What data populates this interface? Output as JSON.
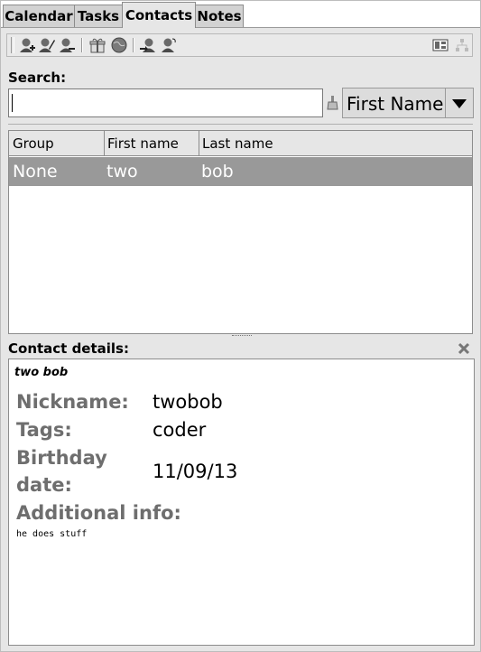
{
  "tabs": [
    {
      "label": "Calendar",
      "active": false
    },
    {
      "label": "Tasks",
      "active": false
    },
    {
      "label": "Contacts",
      "active": true
    },
    {
      "label": "Notes",
      "active": false
    }
  ],
  "toolbar": {
    "buttons": [
      "add-contact-icon",
      "edit-contact-icon",
      "remove-contact-icon",
      "birthday-gift-icon",
      "globe-icon",
      "export-contact-icon",
      "contact-card-icon",
      "view-mode-icon",
      "tree-view-icon"
    ]
  },
  "search": {
    "label": "Search:",
    "value": "",
    "field_selected": "First Name"
  },
  "table": {
    "columns": [
      "Group",
      "First name",
      "Last name"
    ],
    "rows": [
      {
        "group": "None",
        "first": "two",
        "last": "bob",
        "selected": true
      }
    ]
  },
  "details": {
    "header": "Contact details:",
    "full_name": "two bob",
    "nickname_label": "Nickname:",
    "nickname": "twobob",
    "tags_label": "Tags:",
    "tags": "coder",
    "birthday_label_1": "Birthday",
    "birthday_label_2": "date:",
    "birthday": "11/09/13",
    "info_label": "Additional info:",
    "info": "he does stuff"
  },
  "colors": {
    "selected_row": "#999999",
    "label_gray": "#6e6e6e",
    "panel_bg": "#e6e6e6"
  }
}
